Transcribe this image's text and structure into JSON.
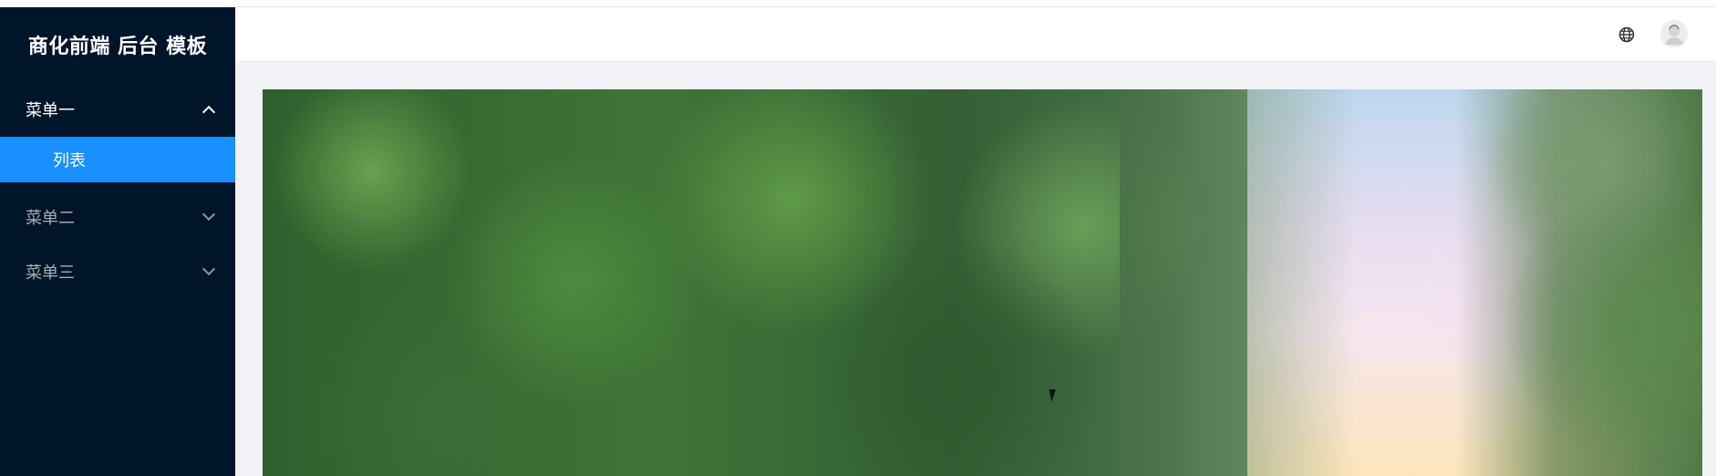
{
  "sidebar": {
    "brand": "商化前端 后台 模板",
    "menus": [
      {
        "label": "菜单一",
        "expanded": true,
        "children": [
          {
            "label": "列表",
            "active": true
          }
        ]
      },
      {
        "label": "菜单二",
        "expanded": false
      },
      {
        "label": "菜单三",
        "expanded": false
      }
    ]
  },
  "header": {
    "icons": [
      "globe-icon",
      "avatar"
    ]
  },
  "colors": {
    "sidebar_bg": "#001529",
    "active_item": "#1890ff",
    "content_bg": "#f0f2f5"
  }
}
